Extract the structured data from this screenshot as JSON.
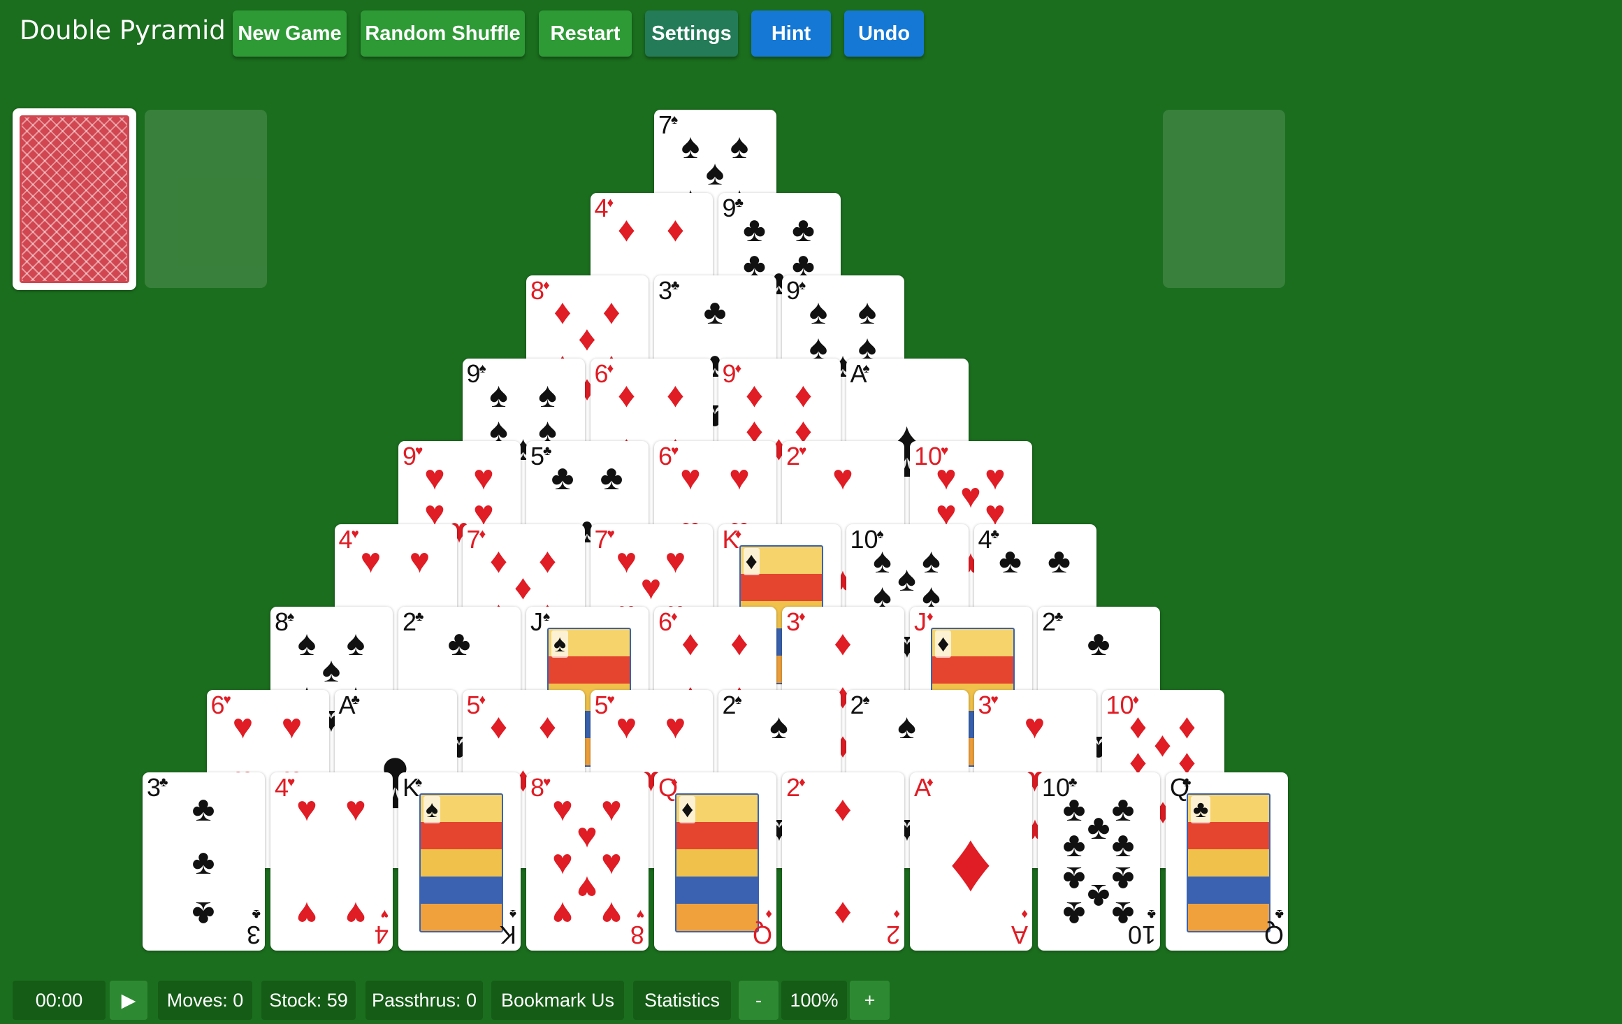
{
  "app": {
    "title": "Double Pyramid"
  },
  "toolbar": {
    "new_game": "New Game",
    "random_shuffle": "Random Shuffle",
    "restart": "Restart",
    "settings": "Settings",
    "hint": "Hint",
    "undo": "Undo"
  },
  "colors": {
    "felt": "#1b6e1e",
    "button_green": "#2e9a36",
    "button_teal": "#237b58",
    "button_blue": "#1478d4",
    "red_suit": "#e01c24",
    "black_suit": "#111111",
    "card_back": "#d14650"
  },
  "pyramid": {
    "rows": [
      [
        {
          "rank": "7",
          "suit": "♠"
        }
      ],
      [
        {
          "rank": "4",
          "suit": "♦"
        },
        {
          "rank": "9",
          "suit": "♣"
        }
      ],
      [
        {
          "rank": "8",
          "suit": "♦"
        },
        {
          "rank": "3",
          "suit": "♣"
        },
        {
          "rank": "9",
          "suit": "♠"
        }
      ],
      [
        {
          "rank": "9",
          "suit": "♠"
        },
        {
          "rank": "6",
          "suit": "♦"
        },
        {
          "rank": "9",
          "suit": "♦"
        },
        {
          "rank": "A",
          "suit": "♠"
        }
      ],
      [
        {
          "rank": "9",
          "suit": "♥"
        },
        {
          "rank": "5",
          "suit": "♣"
        },
        {
          "rank": "6",
          "suit": "♥"
        },
        {
          "rank": "2",
          "suit": "♥"
        },
        {
          "rank": "10",
          "suit": "♥"
        }
      ],
      [
        {
          "rank": "4",
          "suit": "♥"
        },
        {
          "rank": "7",
          "suit": "♦"
        },
        {
          "rank": "7",
          "suit": "♥"
        },
        {
          "rank": "K",
          "suit": "♦"
        },
        {
          "rank": "10",
          "suit": "♠"
        },
        {
          "rank": "4",
          "suit": "♣"
        }
      ],
      [
        {
          "rank": "8",
          "suit": "♠"
        },
        {
          "rank": "2",
          "suit": "♣"
        },
        {
          "rank": "J",
          "suit": "♠"
        },
        {
          "rank": "6",
          "suit": "♦"
        },
        {
          "rank": "3",
          "suit": "♦"
        },
        {
          "rank": "J",
          "suit": "♦"
        },
        {
          "rank": "2",
          "suit": "♣"
        }
      ],
      [
        {
          "rank": "6",
          "suit": "♥"
        },
        {
          "rank": "A",
          "suit": "♣"
        },
        {
          "rank": "5",
          "suit": "♦"
        },
        {
          "rank": "5",
          "suit": "♥"
        },
        {
          "rank": "2",
          "suit": "♠"
        },
        {
          "rank": "2",
          "suit": "♠"
        },
        {
          "rank": "3",
          "suit": "♥"
        },
        {
          "rank": "10",
          "suit": "♦"
        }
      ],
      [
        {
          "rank": "3",
          "suit": "♣"
        },
        {
          "rank": "4",
          "suit": "♥"
        },
        {
          "rank": "K",
          "suit": "♠"
        },
        {
          "rank": "8",
          "suit": "♥"
        },
        {
          "rank": "Q",
          "suit": "♦"
        },
        {
          "rank": "2",
          "suit": "♦"
        },
        {
          "rank": "A",
          "suit": "♦"
        },
        {
          "rank": "10",
          "suit": "♣"
        },
        {
          "rank": "Q",
          "suit": "♣"
        }
      ]
    ]
  },
  "stock_pile": {
    "icon": "card-back"
  },
  "status": {
    "timer": "00:00",
    "play_icon": "▶",
    "moves": "Moves: 0",
    "stock": "Stock: 59",
    "passthrus": "Passthrus: 0",
    "bookmark": "Bookmark Us",
    "statistics": "Statistics",
    "zoom_out": "-",
    "zoom": "100%",
    "zoom_in": "+"
  }
}
